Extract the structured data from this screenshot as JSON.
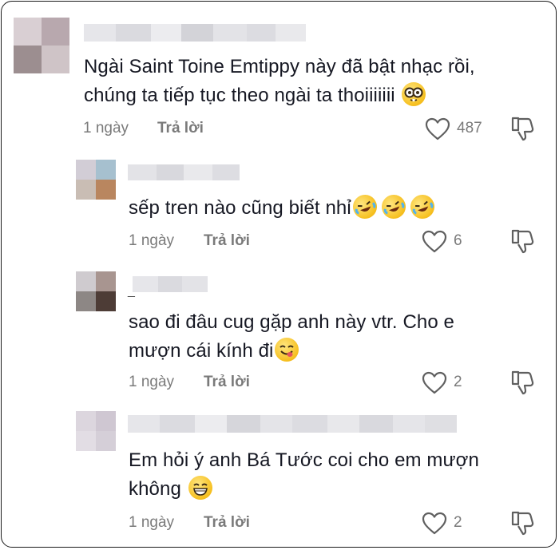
{
  "comments": [
    {
      "text": [
        "Ngài Saint Toine Emtippy này đã bật nhạc rồi,",
        "chúng ta tiếp tục theo ngài ta thoiiiiiii"
      ],
      "emojis": [
        "nerd-glasses-emoji"
      ],
      "time": "1 ngày",
      "reply_label": "Trả lời",
      "likes": "487"
    },
    {
      "text": [
        "sếp tren nào cũng biết nhỉ"
      ],
      "emojis": [
        "rolling-laughing-emoji",
        "rolling-laughing-emoji",
        "rolling-laughing-emoji"
      ],
      "time": "1 ngày",
      "reply_label": "Trả lời",
      "likes": "6"
    },
    {
      "username_prefix": "_",
      "text": [
        "sao đi đâu cug gặp anh này vtr. Cho e",
        "mượn cái kính đi"
      ],
      "emojis": [
        "yum-emoji"
      ],
      "time": "1 ngày",
      "reply_label": "Trả lời",
      "likes": "2"
    },
    {
      "text": [
        "Em hỏi ý anh Bá Tước coi cho em mượn",
        "không"
      ],
      "emojis": [
        "grin-emoji"
      ],
      "time": "1 ngày",
      "reply_label": "Trả lời",
      "likes": "2"
    }
  ],
  "colors": {
    "text": "#161823",
    "meta": "#7a7a7a",
    "border": "#1a1a1a",
    "emoji_yellow": "#f6bf1e"
  }
}
